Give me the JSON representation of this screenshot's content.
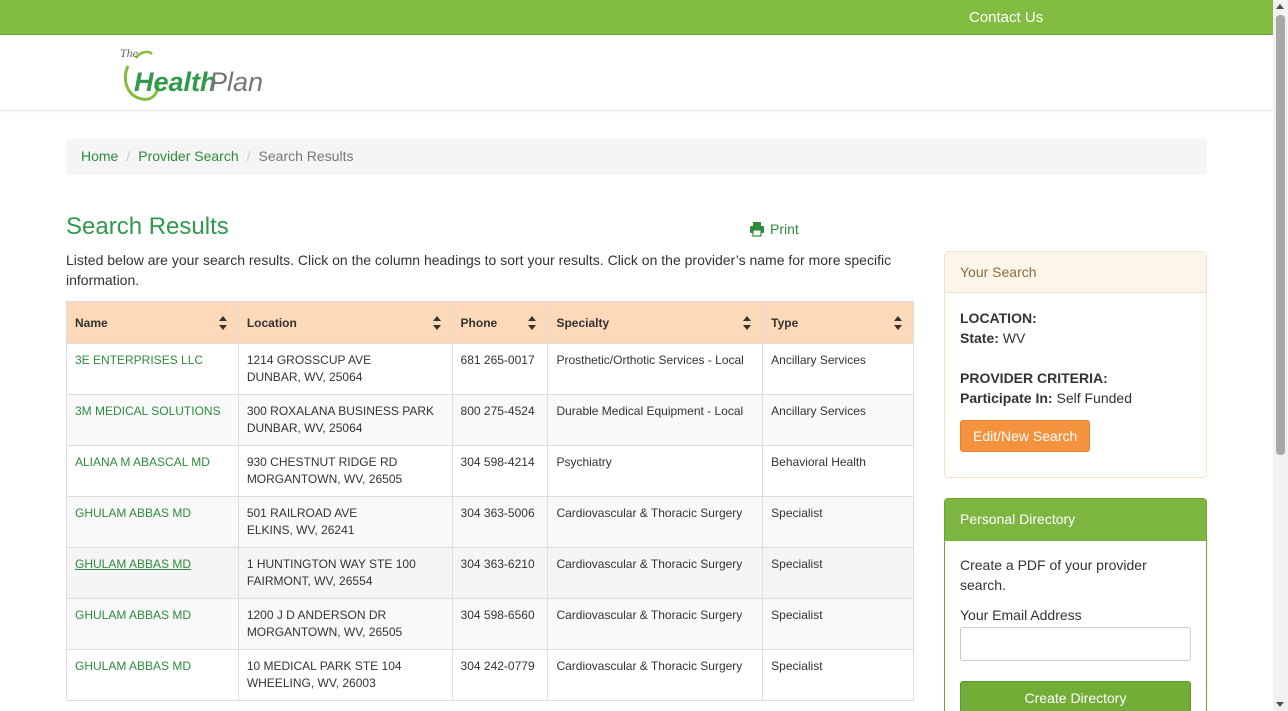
{
  "topbar": {
    "contact_label": "Contact Us",
    "color": "#82bc41"
  },
  "logo": {
    "the": "The",
    "health": "Health",
    "plan": "Plan"
  },
  "breadcrumb": {
    "home": "Home",
    "provider_search": "Provider Search",
    "current": "Search Results"
  },
  "page": {
    "title": "Search Results",
    "print_label": "Print",
    "intro": "Listed below are your search results. Click on the column headings to sort your results. Click on the provider’s name for more specific information."
  },
  "table": {
    "headers": [
      "Name",
      "Location",
      "Phone",
      "Specialty",
      "Type"
    ],
    "rows": [
      {
        "name": "3E ENTERPRISES LLC",
        "addr1": "1214 GROSSCUP AVE",
        "addr2": "DUNBAR, WV, 25064",
        "phone": "681 265-0017",
        "specialty": "Prosthetic/Orthotic Services - Local",
        "type": "Ancillary Services"
      },
      {
        "name": "3M MEDICAL SOLUTIONS",
        "addr1": "300 ROXALANA BUSINESS PARK",
        "addr2": "DUNBAR, WV, 25064",
        "phone": "800 275-4524",
        "specialty": "Durable Medical Equipment - Local",
        "type": "Ancillary Services"
      },
      {
        "name": "ALIANA M ABASCAL MD",
        "addr1": "930 CHESTNUT RIDGE RD",
        "addr2": "MORGANTOWN, WV, 26505",
        "phone": "304 598-4214",
        "specialty": "Psychiatry",
        "type": "Behavioral Health"
      },
      {
        "name": "GHULAM ABBAS MD",
        "addr1": "501 RAILROAD AVE",
        "addr2": "ELKINS, WV, 26241",
        "phone": "304 363-5006",
        "specialty": "Cardiovascular & Thoracic Surgery",
        "type": "Specialist"
      },
      {
        "name": "GHULAM ABBAS MD",
        "addr1": "1 HUNTINGTON WAY STE 100",
        "addr2": "FAIRMONT, WV, 26554",
        "phone": "304 363-6210",
        "specialty": "Cardiovascular & Thoracic Surgery",
        "type": "Specialist"
      },
      {
        "name": "GHULAM ABBAS MD",
        "addr1": "1200 J D ANDERSON DR",
        "addr2": "MORGANTOWN, WV, 26505",
        "phone": "304 598-6560",
        "specialty": "Cardiovascular & Thoracic Surgery",
        "type": "Specialist"
      },
      {
        "name": "GHULAM ABBAS MD",
        "addr1": "10 MEDICAL PARK STE 104",
        "addr2": "WHEELING, WV, 26003",
        "phone": "304 242-0779",
        "specialty": "Cardiovascular & Thoracic Surgery",
        "type": "Specialist"
      }
    ]
  },
  "your_search": {
    "heading": "Your Search",
    "location_label": "LOCATION:",
    "state_label": "State:",
    "state_value": " WV",
    "criteria_label": "PROVIDER CRITERIA:",
    "participate_label": "Participate In:",
    "participate_value": " Self Funded",
    "edit_button": "Edit/New Search"
  },
  "personal_directory": {
    "heading": "Personal Directory",
    "description": "Create a PDF of your provider search.",
    "email_label": "Your Email Address",
    "email_value": "",
    "create_button": "Create Directory"
  },
  "colors": {
    "brand_green": "#2e9a4a",
    "header_orange": "#fcd9b8",
    "button_orange": "#f5923e",
    "button_green": "#72ad38"
  }
}
